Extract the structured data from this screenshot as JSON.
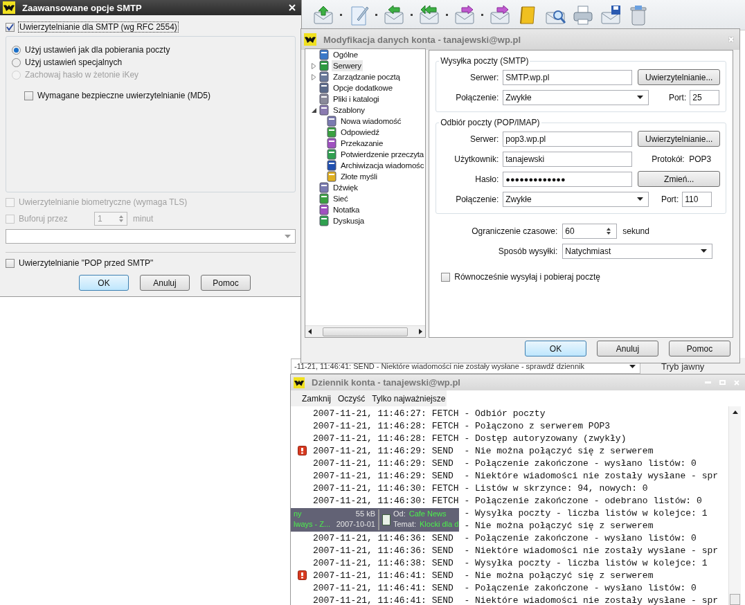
{
  "smtp_dialog": {
    "title": "Zaawansowane opcje SMTP",
    "auth": {
      "label": "Uwierzytelnianie dla SMTP (wg RFC 2554)",
      "checked": true
    },
    "modes": [
      {
        "label": "Użyj ustawień jak dla pobierania poczty",
        "selected": true,
        "disabled": false
      },
      {
        "label": "Użyj ustawień specjalnych",
        "selected": false,
        "disabled": false
      },
      {
        "label": "Zachowaj hasło w żetonie iKey",
        "selected": false,
        "disabled": true
      }
    ],
    "md5": {
      "label": "Wymagane bezpieczne uwierzytelnianie (MD5)",
      "checked": false
    },
    "biometric": {
      "label": "Uwierzytelnianie biometryczne (wymaga TLS)",
      "checked": false,
      "disabled": true
    },
    "buffer": {
      "label": "Buforuj przez",
      "checked": false,
      "disabled": true,
      "value": "1",
      "unit": "minut"
    },
    "pop_before_smtp": {
      "label": "Uwierzytelnianie \"POP przed SMTP\"",
      "checked": false
    },
    "buttons": [
      {
        "label": "OK",
        "default": true
      },
      {
        "label": "Anuluj",
        "default": false
      },
      {
        "label": "Pomoc",
        "default": false
      }
    ]
  },
  "status_strip": {
    "message": "-11-21, 11:46:41: SEND  - Niektóre wiadomości nie zostały wysłane - sprawdź dziennik",
    "mode": "Tryb jawny"
  },
  "account_dialog": {
    "title": "Modyfikacja danych konta - tanajewski@wp.pl",
    "tree": [
      {
        "label": "Ogólne",
        "selected": false
      },
      {
        "label": "Serwery",
        "selected": true,
        "expanded": false
      },
      {
        "label": "Zarządzanie pocztą",
        "selected": false,
        "expanded": false
      },
      {
        "label": "Opcje dodatkowe",
        "selected": false
      },
      {
        "label": "Pliki i katalogi",
        "selected": false
      },
      {
        "label": "Szablony",
        "selected": false,
        "expanded": true,
        "children": [
          {
            "label": "Nowa wiadomość",
            "selected": false
          },
          {
            "label": "Odpowiedź",
            "selected": false
          },
          {
            "label": "Przekazanie",
            "selected": false
          },
          {
            "label": "Potwierdzenie przeczyta",
            "selected": false
          },
          {
            "label": "Archiwizacja wiadomośc",
            "selected": false
          },
          {
            "label": "Złote myśli",
            "selected": false
          }
        ]
      },
      {
        "label": "Dźwięk",
        "selected": false
      },
      {
        "label": "Sieć",
        "selected": false
      },
      {
        "label": "Notatka",
        "selected": false
      },
      {
        "label": "Dyskusja",
        "selected": false
      }
    ],
    "smtp": {
      "legend": "Wysyłka poczty (SMTP)",
      "server_label": "Serwer:",
      "server": "SMTP.wp.pl",
      "auth_button": "Uwierzytelnianie...",
      "connection_label": "Połączenie:",
      "connection": "Zwykłe",
      "port_label": "Port:",
      "port": "25"
    },
    "pop": {
      "legend": "Odbiór poczty (POP/IMAP)",
      "server_label": "Serwer:",
      "server": "pop3.wp.pl",
      "auth_button": "Uwierzytelnianie...",
      "user_label": "Użytkownik:",
      "user": "tanajewski",
      "protocol_label": "Protokół:",
      "protocol": "POP3",
      "password_label": "Hasło:",
      "password": "●●●●●●●●●●●●●",
      "change_button": "Zmień...",
      "connection_label": "Połączenie:",
      "connection": "Zwykłe",
      "port_label": "Port:",
      "port": "110"
    },
    "timeout": {
      "label": "Ograniczenie czasowe:",
      "value": "60",
      "unit": "sekund"
    },
    "send_mode": {
      "label": "Sposób wysyłki:",
      "value": "Natychmiast"
    },
    "simultaneous": {
      "label": "Równocześnie wysyłaj i pobieraj pocztę",
      "checked": false
    },
    "buttons": [
      {
        "label": "OK",
        "default": true
      },
      {
        "label": "Anuluj",
        "default": false
      },
      {
        "label": "Pomoc",
        "default": false
      }
    ]
  },
  "log_window": {
    "title": "Dziennik konta - tanajewski@wp.pl",
    "menu": [
      "Zamknij",
      "Oczyść",
      "Tylko najważniejsze"
    ],
    "lines": [
      {
        "prefix": "2007-11-21, 11:46:27: FETCH",
        "message": "- Odbiór poczty",
        "error": false
      },
      {
        "prefix": "2007-11-21, 11:46:28: FETCH",
        "message": "- Połączono z serwerem POP3",
        "error": false
      },
      {
        "prefix": "2007-11-21, 11:46:28: FETCH",
        "message": "- Dostęp autoryzowany (zwykły)",
        "error": false
      },
      {
        "prefix": "2007-11-21, 11:46:29: SEND",
        "message": "- Nie można połączyć się z serwerem",
        "error": true
      },
      {
        "prefix": "2007-11-21, 11:46:29: SEND",
        "message": "- Połączenie zakończone - wysłano listów: 0",
        "error": false
      },
      {
        "prefix": "2007-11-21, 11:46:29: SEND",
        "message": "- Niektóre wiadomości nie zostały wysłane - spr",
        "error": false
      },
      {
        "prefix": "2007-11-21, 11:46:30: FETCH",
        "message": "- Listów w skrzynce: 94, nowych: 0",
        "error": false
      },
      {
        "prefix": "2007-11-21, 11:46:30: FETCH",
        "message": "- Połączenie zakończone - odebrano listów: 0",
        "error": false
      },
      {
        "message": "- Wysyłka poczty - liczba listów w kolejce: 1",
        "error": false
      },
      {
        "message": "- Nie można połączyć się z serwerem",
        "error": false
      },
      {
        "prefix": "2007-11-21, 11:46:36: SEND",
        "message": "- Połączenie zakończone - wysłano listów: 0",
        "error": false
      },
      {
        "prefix": "2007-11-21, 11:46:36: SEND",
        "message": "- Niektóre wiadomości nie zostały wysłane - spr",
        "error": false
      },
      {
        "prefix": "2007-11-21, 11:46:38: SEND",
        "message": "- Wysyłka poczty - liczba listów w kolejce: 1",
        "error": false
      },
      {
        "prefix": "2007-11-21, 11:46:41: SEND",
        "message": "- Nie można połączyć się z serwerem",
        "error": true
      },
      {
        "prefix": "2007-11-21, 11:46:41: SEND",
        "message": "- Połączenie zakończone - wysłano listów: 0",
        "error": false
      },
      {
        "prefix": "2007-11-21, 11:46:41: SEND",
        "message": "- Niektóre wiadomości nie zostały wysłane - spr",
        "error": false
      }
    ]
  },
  "notification": {
    "name": "ny",
    "size": "55 kB",
    "from_label": "Od:",
    "from": "Cafe News",
    "subject_prefix": "lways - Z...",
    "date": "2007-10-01",
    "subject_label": "Temat:",
    "subject": "Klocki dla d"
  }
}
